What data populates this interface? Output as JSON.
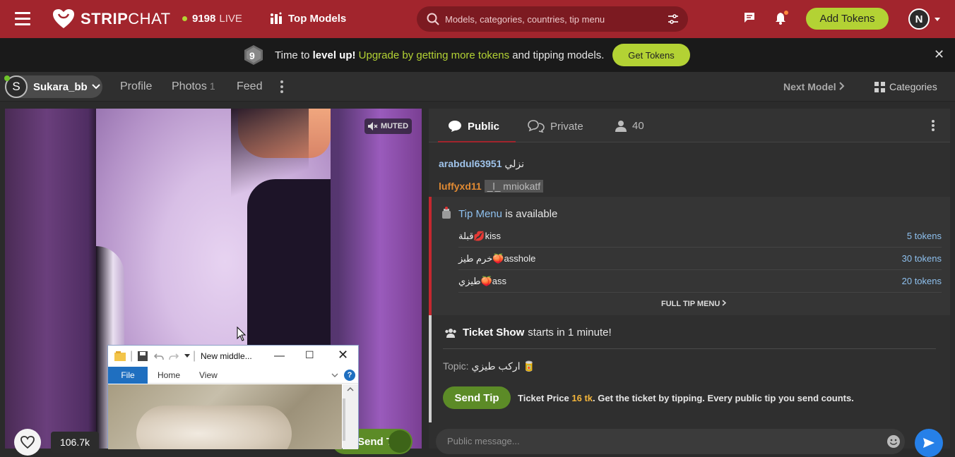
{
  "topbar": {
    "logo_text_bold": "STRIP",
    "logo_text_thin": "CHAT",
    "live_count": "9198",
    "live_label": "LIVE",
    "top_models": "Top Models",
    "search_placeholder": "Models, categories, countries, tip menu",
    "add_tokens": "Add Tokens",
    "user_initial": "N",
    "colors": {
      "brand": "#a2252d",
      "accent": "#b3d234"
    }
  },
  "promo": {
    "level": "9",
    "text_a": "Time to ",
    "text_b": "level up!",
    "text_c": " Upgrade by getting more tokens",
    "text_d": " and tipping models.",
    "button": "Get Tokens",
    "close": "✕"
  },
  "modelbar": {
    "initial": "S",
    "name": "Sukara_bb",
    "tabs": [
      {
        "label": "Profile"
      },
      {
        "label": "Photos",
        "count": "1"
      },
      {
        "label": "Feed"
      }
    ],
    "next_model": "Next Model",
    "categories": "Categories"
  },
  "video": {
    "muted": "MUTED",
    "likes": "106.7k",
    "send_tip": "Send Tip"
  },
  "explorer_window": {
    "title": "New middle...",
    "tabs": [
      "File",
      "Home",
      "View"
    ],
    "help": "?"
  },
  "chat": {
    "tabs": {
      "public": "Public",
      "private": "Private",
      "viewers": "40"
    },
    "messages": [
      {
        "user": "arabdul63951",
        "text": "نزلي"
      },
      {
        "user": "luffyxd11",
        "text": "_l_ mniokatf"
      }
    ],
    "tip_menu": {
      "link": "Tip Menu",
      "suffix": " is available",
      "items": [
        {
          "name": "قبلة💋kiss",
          "price": "5 tokens"
        },
        {
          "name": "خرم طيز🍑asshole",
          "price": "30 tokens"
        },
        {
          "name": "طيزي🍑ass",
          "price": "20 tokens"
        }
      ],
      "full": "FULL TIP MENU"
    },
    "ticket": {
      "title": "Ticket Show",
      "starts": "starts in 1 minute!",
      "topic_label": "Topic:",
      "topic": "اركب طيزي 🥫",
      "send_tip": "Send Tip",
      "price_a": "Ticket Price ",
      "price_amt": "16 tk",
      "price_b": ". Get the ticket by tipping. Every public tip you send counts."
    },
    "input_placeholder": "Public message..."
  }
}
